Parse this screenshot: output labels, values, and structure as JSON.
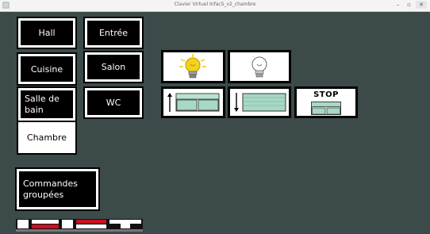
{
  "window": {
    "title": "Clavier Virtuel InfacS_v2_chambre",
    "minimize_glyph": "–",
    "maximize_glyph": "▫",
    "close_glyph": "✕"
  },
  "rooms": {
    "hall": "Hall",
    "entree": "Entrée",
    "cuisine": "Cuisine",
    "salon": "Salon",
    "salle_de_bain_line1": "Salle de",
    "salle_de_bain_line2": "bain",
    "wc": "WC",
    "chambre": "Chambre",
    "grouped_line1": "Commandes",
    "grouped_line2": "groupées"
  },
  "controls": {
    "light_on_icon": "lightbulb-on-icon",
    "light_off_icon": "lightbulb-off-icon",
    "shutter_up_icon": "shutter-up-icon",
    "shutter_down_icon": "shutter-down-icon",
    "stop_label": "STOP"
  },
  "logo": {
    "text": "IRIT",
    "colors": {
      "red": "#c8101e",
      "white": "#ffffff"
    }
  },
  "colors": {
    "background": "#3c4a4a",
    "button": "#000000",
    "selected": "#ffffff",
    "bulb_on": "#f2d21f",
    "shutter": "#a7d9c4"
  }
}
